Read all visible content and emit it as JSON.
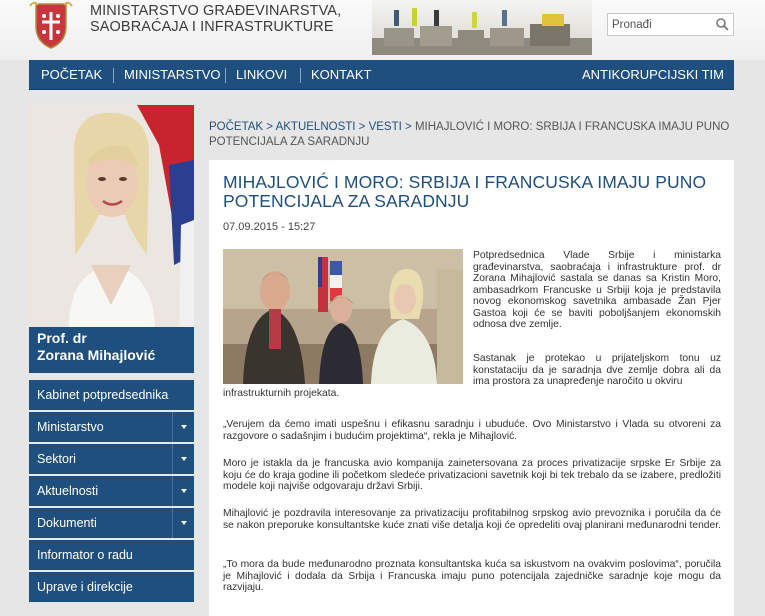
{
  "header": {
    "title_line1": "MINISTARSTVO GRAĐEVINARSTVA,",
    "title_line2": "SAOBRAĆAJA I INFRASTRUKTURE",
    "search_placeholder": "Pronađi"
  },
  "nav": {
    "items": [
      "POČETAK",
      "MINISTARSTVO",
      "LINKOVI",
      "KONTAKT"
    ],
    "right_item": "ANTIKORUPCIJSKI TIM"
  },
  "minister": {
    "line1": "Prof. dr",
    "line2": "Zorana Mihajlović"
  },
  "sidebar": {
    "items": [
      {
        "label": "Kabinet potpredsednika"
      },
      {
        "label": "Ministarstvo"
      },
      {
        "label": "Sektori"
      },
      {
        "label": "Aktuelnosti"
      },
      {
        "label": "Dokumenti"
      },
      {
        "label": "Informator o radu"
      },
      {
        "label": "Uprave i direkcije"
      }
    ]
  },
  "breadcrumb": {
    "home": "POČETAK",
    "news": "AKTUELNOSTI",
    "section": "VESTI",
    "current": "MIHAJLOVIĆ I MORO: SRBIJA I FRANCUSKA IMAJU PUNO POTENCIJALA ZA SARADNJU",
    "sep": " > "
  },
  "article": {
    "title_line1": "MIHAJLOVIĆ I MORO: SRBIJA I FRANCUSKA IMAJU PUNO",
    "title_line2": "POTENCIJALA ZA SARADNJU",
    "date": "07.09.2015 - 15:27",
    "p1": "Potpredsednica Vlade Srbije i ministarka građevinarstva, saobraćaja i infrastrukture prof. dr Zorana Mihajlović sastala se danas sa Kristin Moro, ambasadrkom Francuske u Srbiji koja je predstavila novog ekonomskog savetnika ambasade Žan Pjer Gastoa koji će se baviti poboljšanjem ekonomskih odnosa dve zemlje.",
    "p2a": "Sastanak je protekao u prijateljskom tonu uz konstataciju da je saradnja dve zemlje dobra ali da ima prostora za unapređenje naročito u okviru",
    "p2b": "infrastrukturnih projekata.",
    "p3": "„Verujem da ćemo imati uspešnu i efikasnu saradnju i ubuduće. Ovo Ministarstvo i Vlada su otvoreni za razgovore o sadašnjim i budućim projektima“, rekla je Mihajlović.",
    "p4": "Moro je istakla da je francuska avio kompanija zainetersovana za proces privatizacije srpske Er Srbije za koju će do kraja godine ili početkom sledeće privatizacioni savetnik koji bi  tek trebalo da se izabere, predložiti modele koji najviše odgovaraju državi Srbiji.",
    "p5": "Mihajlović je pozdravila interesovanje za privatizaciju profitabilnog srpskog avio prevoznika i poručila da će se nakon preporuke konsultantske kuće znati više detalja koji će opredeliti ovaj planirani međunarodni tender.",
    "p6": "„To mora da bude međunarodno proznata konsultantska kuća sa iskustvom na ovakvim poslovima“, poručila je Mihajlović i dodala da Srbija i Francuska imaju puno potencijala zajedničke saradnje koje mogu da razvijaju."
  },
  "colors": {
    "brand_blue": "#1f4f7e",
    "background": "#e6e6e6"
  }
}
